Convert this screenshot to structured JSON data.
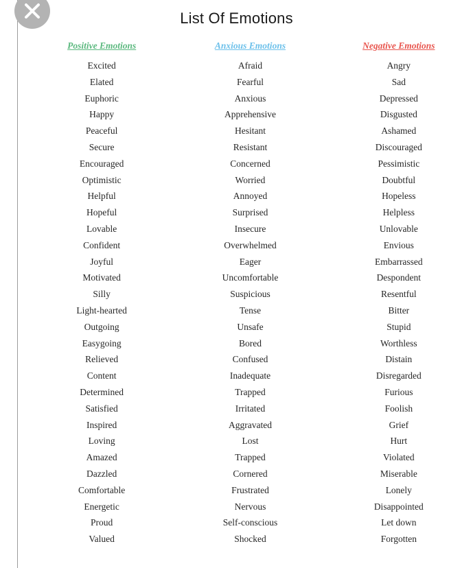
{
  "page": {
    "title": "List Of Emotions"
  },
  "close_button": {
    "icon": "close-x-icon",
    "label": "Close",
    "color": "#b3b3b3",
    "glyph_color": "#ffffff"
  },
  "columns": [
    {
      "id": "positive",
      "header": "Positive Emotions",
      "color": "#5cb97f",
      "items": [
        "Excited",
        "Elated",
        "Euphoric",
        "Happy",
        "Peaceful",
        "Secure",
        "Encouraged",
        "Optimistic",
        "Helpful",
        "Hopeful",
        "Lovable",
        "Confident",
        "Joyful",
        "Motivated",
        "Silly",
        "Light-hearted",
        "Outgoing",
        "Easygoing",
        "Relieved",
        "Content",
        "Determined",
        "Satisfied",
        "Inspired",
        "Loving",
        "Amazed",
        "Dazzled",
        "Comfortable",
        "Energetic",
        "Proud",
        "Valued"
      ]
    },
    {
      "id": "anxious",
      "header": "Anxious Emotions",
      "color": "#6cc0ea",
      "items": [
        "Afraid",
        "Fearful",
        "Anxious",
        "Apprehensive",
        "Hesitant",
        "Resistant",
        "Concerned",
        "Worried",
        "Annoyed",
        "Surprised",
        "Insecure",
        "Overwhelmed",
        "Eager",
        "Uncomfortable",
        "Suspicious",
        "Tense",
        "Unsafe",
        "Bored",
        "Confused",
        "Inadequate",
        "Trapped",
        "Irritated",
        "Aggravated",
        "Lost",
        "Trapped",
        "Cornered",
        "Frustrated",
        "Nervous",
        "Self-conscious",
        "Shocked"
      ]
    },
    {
      "id": "negative",
      "header": "Negative Emotions",
      "color": "#e8554e",
      "items": [
        "Angry",
        "Sad",
        "Depressed",
        "Disgusted",
        "Ashamed",
        "Discouraged",
        "Pessimistic",
        "Doubtful",
        "Hopeless",
        "Helpless",
        "Unlovable",
        "Envious",
        "Embarrassed",
        "Despondent",
        "Resentful",
        "Bitter",
        "Stupid",
        "Worthless",
        "Distain",
        "Disregarded",
        "Furious",
        "Foolish",
        "Grief",
        "Hurt",
        "Violated",
        "Miserable",
        "Lonely",
        "Disappointed",
        "Let down",
        "Forgotten"
      ]
    }
  ]
}
